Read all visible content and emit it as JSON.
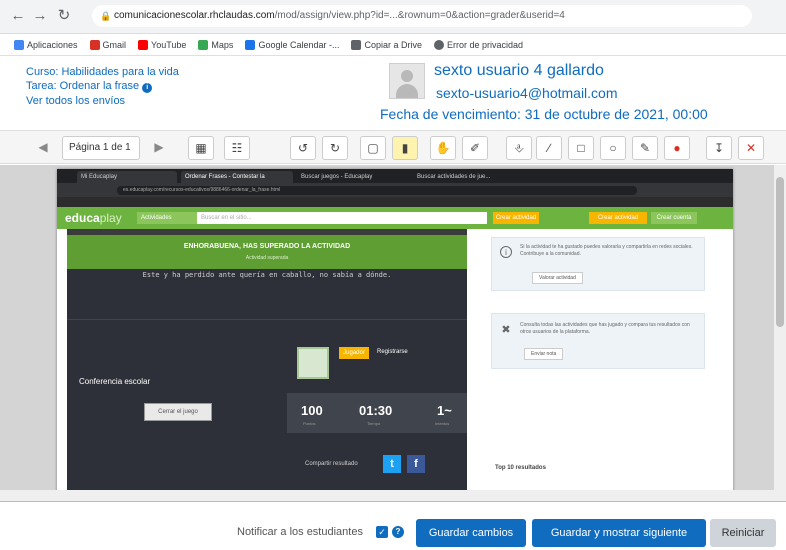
{
  "browser": {
    "url_host": "comunicacionescolar.rhclaudas.com",
    "url_path": "/mod/assign/view.php?id=...&rownum=0&action=grader&userid=4",
    "bookmarks": [
      {
        "label": "Aplicaciones",
        "color": "#4285f4"
      },
      {
        "label": "Gmail",
        "color": "#d93025"
      },
      {
        "label": "YouTube",
        "color": "#ff0000"
      },
      {
        "label": "Maps",
        "color": "#34a853"
      },
      {
        "label": "Google Calendar -...",
        "color": "#1a73e8"
      },
      {
        "label": "Copiar a Drive",
        "color": "#5f6368"
      },
      {
        "label": "Error de privacidad",
        "color": "#5f6368"
      }
    ]
  },
  "header": {
    "course": "Curso: Habilidades para la vida",
    "task": "Tarea: Ordenar la frase",
    "view_all": "Ver todos los envíos",
    "user_name": "sexto usuario 4 gallardo",
    "user_email": "sexto-usuario4@hotmail.com",
    "due_date": "Fecha de vencimiento: 31 de octubre de 2021, 00:00"
  },
  "toolbar": {
    "page_label": "Página 1 de 1"
  },
  "embedded": {
    "tabs": [
      "Mi Educaplay",
      "Ordenar Frases - Contestar la",
      "Buscar juegos - Educaplay",
      "Buscar actividades de jue..."
    ],
    "address": "es.educaplay.com/recursos-educativos/9886466-ordenar_la_frase.html",
    "logo_main": "educa",
    "logo_accent": "play",
    "select_label": "Actividades",
    "search_placeholder": "Buscar en el sitio...",
    "btn_nuevo": "Crear actividad",
    "btn_acceder": "Crear actividad",
    "btn_crear": "Crear cuenta",
    "congrats": "ENHORABUENA, HAS SUPERADO LA ACTIVIDAD",
    "congrats_sub": "Actividad superada",
    "message": "Este y ha perdido ante quería en caballo, no sabía a dónde.",
    "language": "Conferencia escolar",
    "close_button": "Cerrar el juego",
    "player_badge": "Jugador",
    "player_name": "Registrarse",
    "stats": [
      {
        "value": "100",
        "label": "Puntos"
      },
      {
        "value": "01:30",
        "label": "Tiempo"
      },
      {
        "value": "1~",
        "label": "Intentos"
      }
    ],
    "share_label": "Compartir resultado",
    "card1_text": "Si la actividad te ha gustado puedes valorarla y compartirla en redes sociales. Contribuye a la comunidad.",
    "card1_button": "Valorar actividad",
    "card2_text": "Consulta todas las actividades que has jugado y compara tus resultados con otros usuarios de la plataforma.",
    "card2_button": "Enviar nota",
    "top_label": "Top 10 resultados"
  },
  "footer": {
    "notify_label": "Notificar a los estudiantes",
    "save_label": "Guardar cambios",
    "save_next_label": "Guardar y mostrar siguiente",
    "reset_label": "Reiniciar"
  },
  "colors": {
    "primary": "#0f6cbf",
    "educaplay_green": "#6db33f",
    "educaplay_orange": "#f7b500"
  },
  "icons": [
    "back-icon",
    "forward-icon",
    "reload-icon",
    "lock-icon",
    "rotate-left-icon",
    "rotate-right-icon",
    "select-icon",
    "comment-icon",
    "stamp-icon",
    "pen-icon",
    "line-icon",
    "rectangle-icon",
    "oval-icon",
    "highlighter-icon",
    "color-icon",
    "download-icon",
    "close-icon",
    "help-icon"
  ]
}
